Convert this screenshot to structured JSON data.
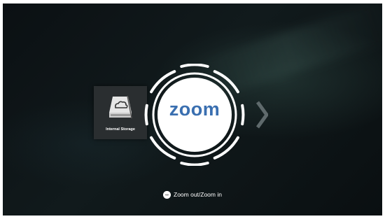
{
  "storage": {
    "label": "Internal Storage",
    "icon": "storage-drive-cloud-icon"
  },
  "zoom": {
    "label": "zoom",
    "color": "#3a6fb0"
  },
  "navigation": {
    "next_icon": "chevron-right-icon"
  },
  "hint": {
    "icon": "remote-dpad-icon",
    "text": "Zoom out/Zoom in"
  }
}
